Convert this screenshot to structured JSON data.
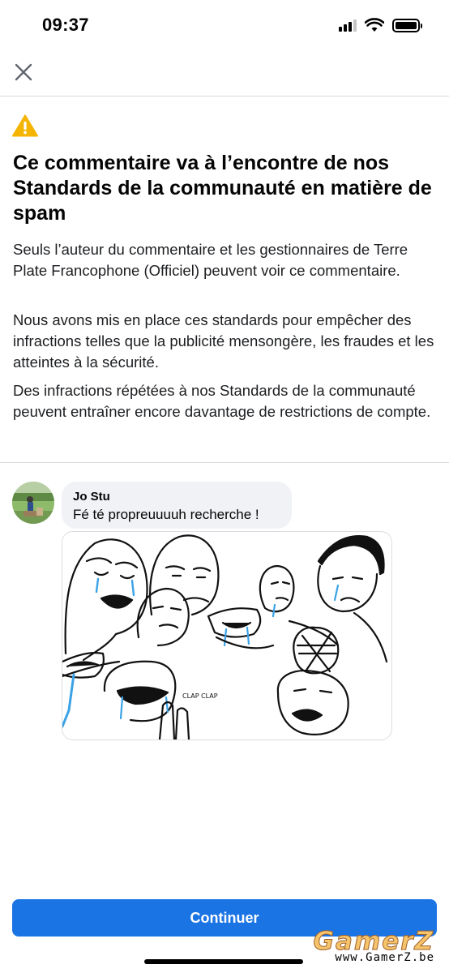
{
  "status_bar": {
    "time": "09:37"
  },
  "icons": {
    "close": "close-icon",
    "warning": "warning-icon",
    "signal": "cellular-signal-icon",
    "wifi": "wifi-icon",
    "battery": "battery-icon"
  },
  "colors": {
    "warning": "#f5b400",
    "primary_button": "#1b74e4",
    "bubble_background": "#f0f2f5"
  },
  "notice": {
    "title": "Ce commentaire va à l’encontre de nos Standards de la communauté en matière de spam",
    "paragraphs": [
      "Seuls l’auteur du commentaire et les gestionnaires de Terre Plate Francophone (Officiel) peuvent voir ce commentaire.",
      "Nous avons mis en place ces standards pour empêcher des infractions telles que la publicité mensongère, les fraudes et les atteintes à la sécurité.",
      "Des infractions répétées à nos Standards de la communauté peuvent entraîner encore davantage de restrictions de compte."
    ]
  },
  "comment": {
    "author": "Jo Stu",
    "text": "Fé té propreuuuuh recherche !",
    "image_caption": "CLAP CLAP"
  },
  "actions": {
    "continue_label": "Continuer"
  },
  "watermark": {
    "logo": "GamerZ",
    "url": "www.GamerZ.be"
  }
}
